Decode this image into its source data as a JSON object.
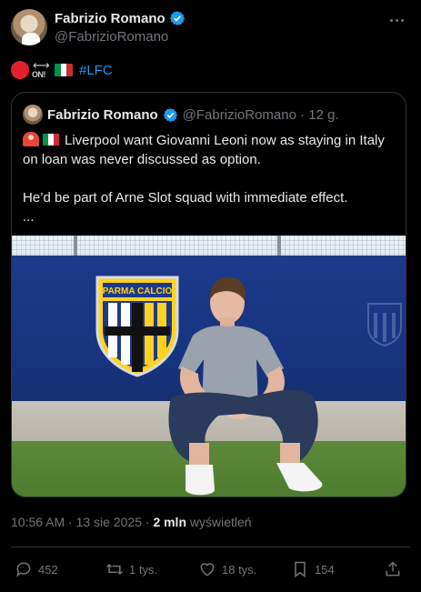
{
  "author": {
    "name": "Fabrizio Romano",
    "handle": "@FabrizioRomano"
  },
  "tweet": {
    "on_label": "ON!",
    "hashtag": "#LFC"
  },
  "quoted": {
    "name": "Fabrizio Romano",
    "handle_time": "@FabrizioRomano · 12 g.",
    "text_line1": "Liverpool want Giovanni Leoni now as staying in Italy on loan was never discussed as option.",
    "text_line2": "He’d be part of Arne Slot squad with immediate effect.",
    "text_line3": "...",
    "photo_sign": "PARMA CALCIO"
  },
  "meta": {
    "datetime": "10:56 AM · 13 sie 2025 · ",
    "views_count": "2 mln",
    "views_label": " wyświetleń"
  },
  "actions": {
    "replies": "452",
    "reposts": "1 tys.",
    "likes": "18 tys.",
    "bookmarks": "154"
  },
  "colors": {
    "accent": "#1d9bf0",
    "background": "#000000",
    "muted": "#71767b"
  }
}
